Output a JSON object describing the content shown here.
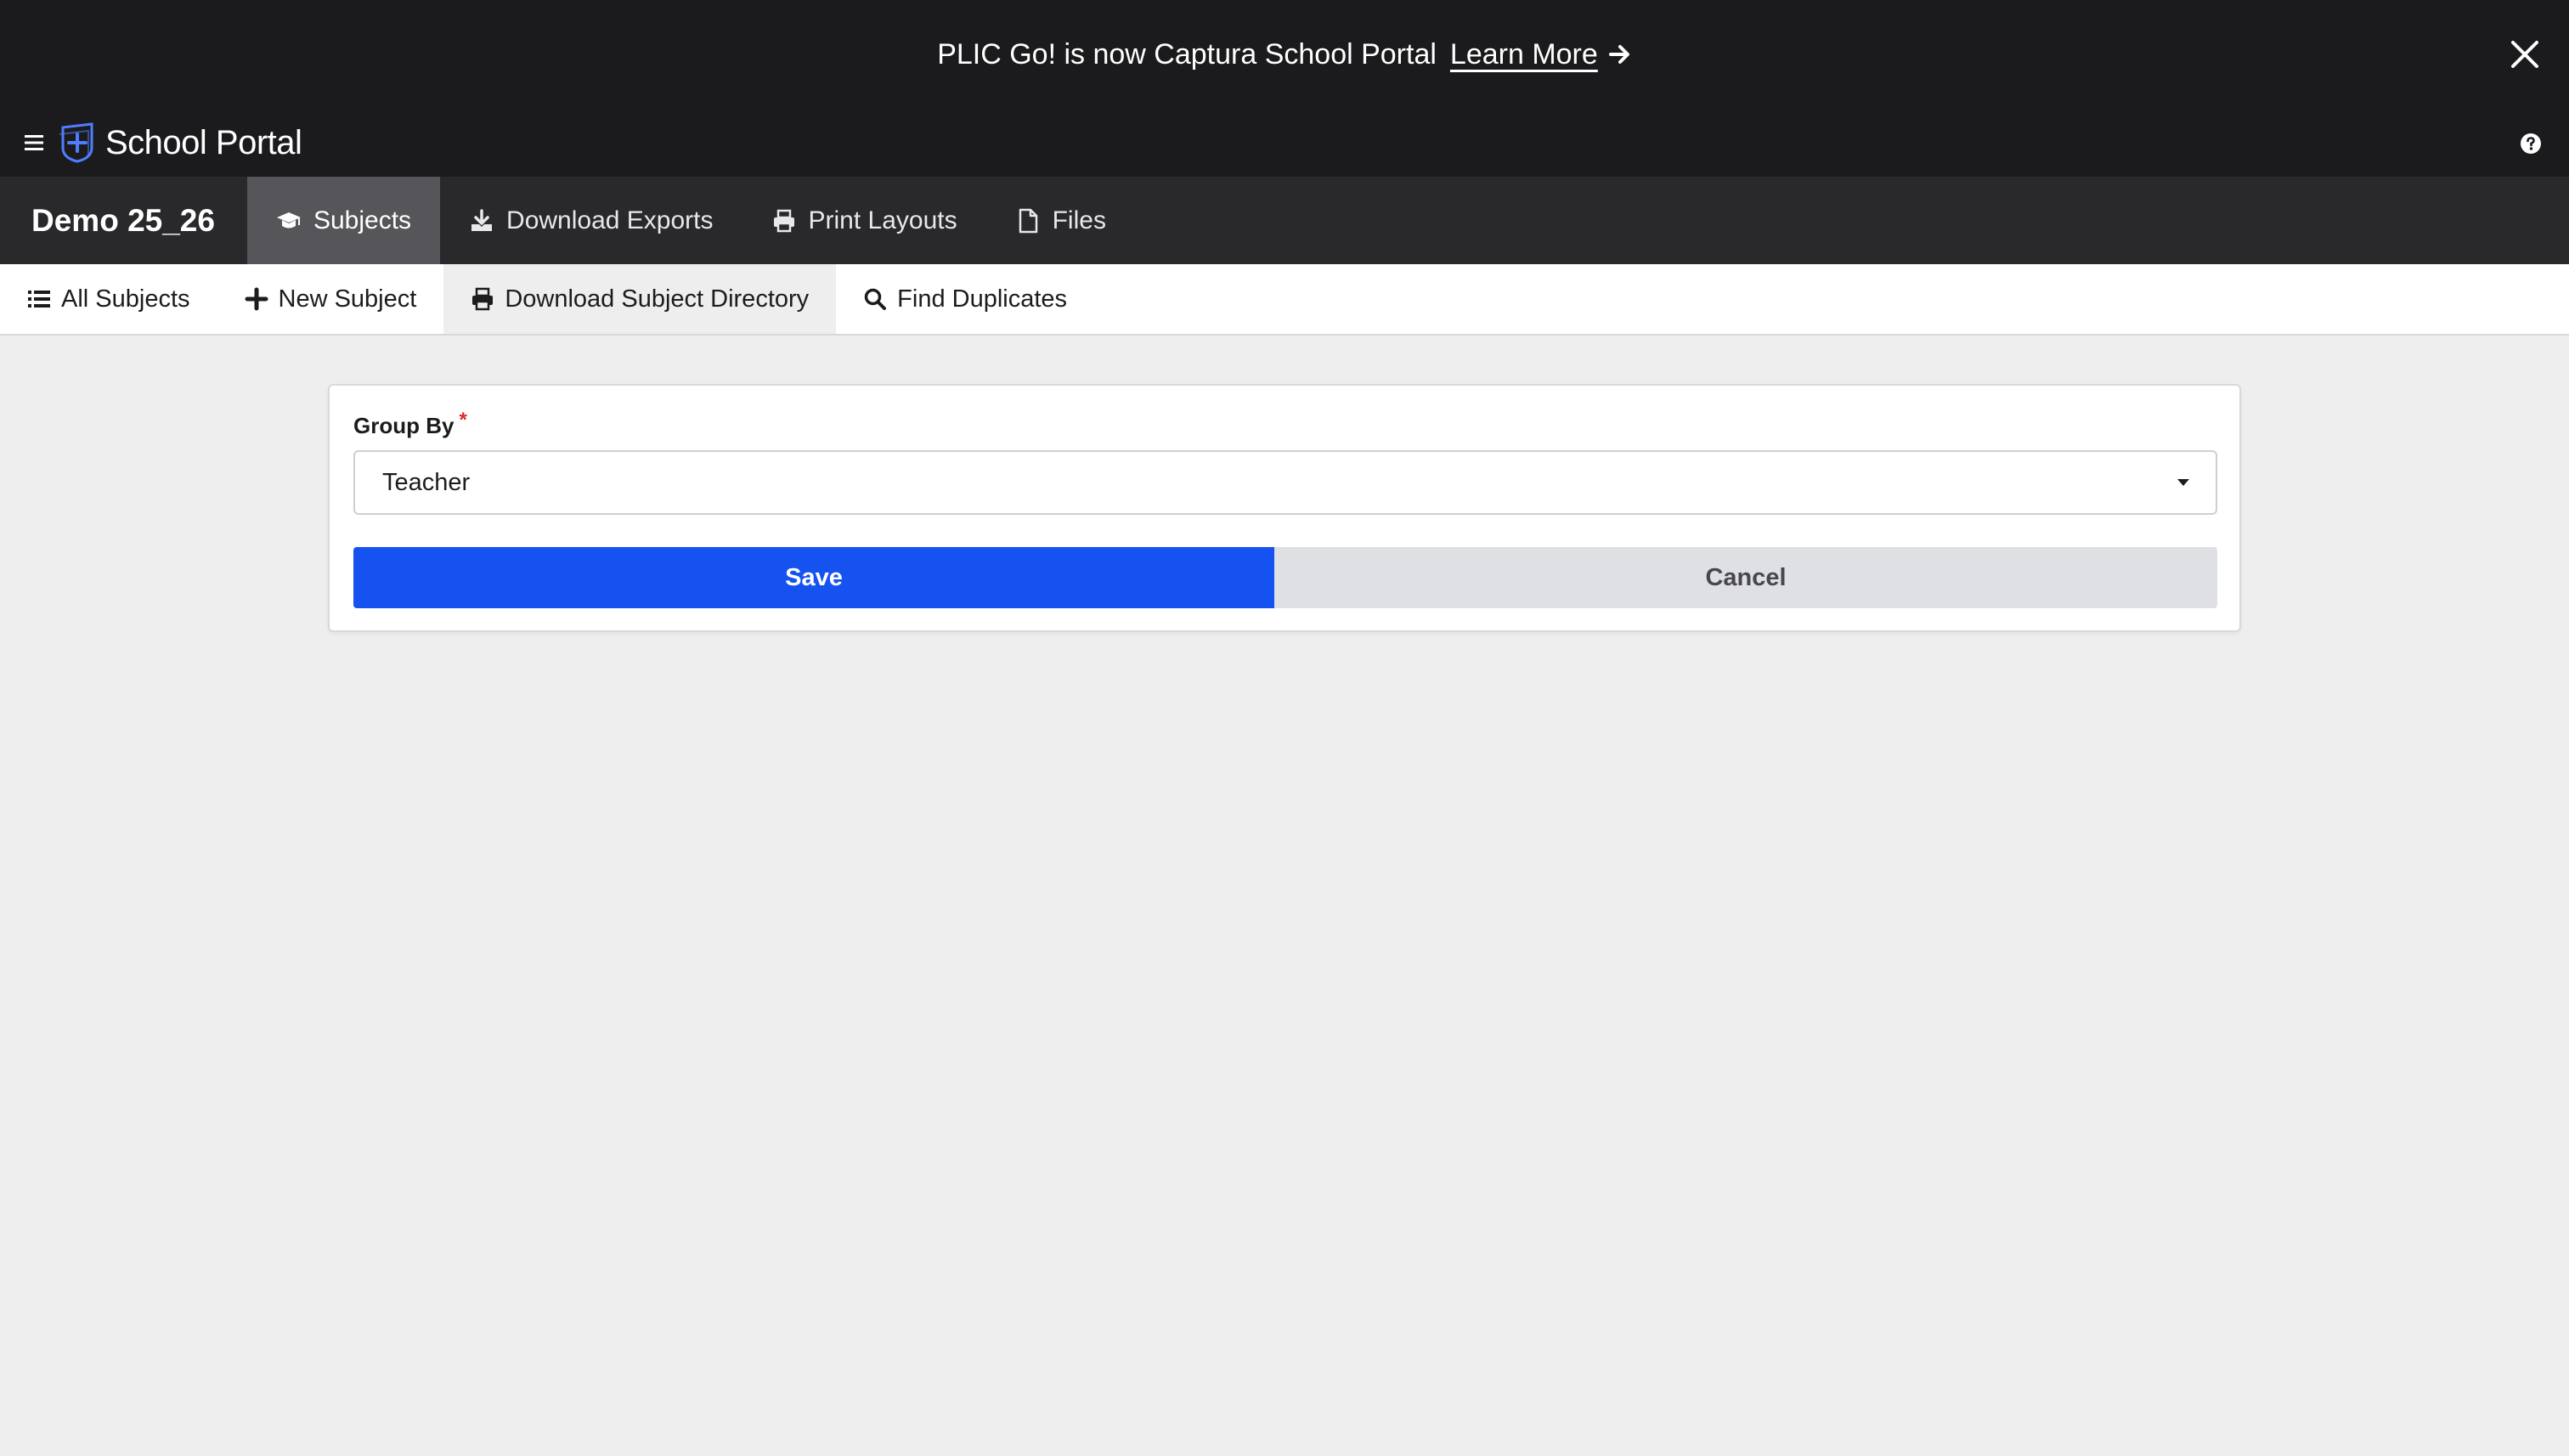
{
  "banner": {
    "message": "PLIC Go! is now Captura School Portal",
    "link_label": "Learn More",
    "icons": [
      "arrow-right-icon",
      "close-icon"
    ]
  },
  "app": {
    "brand": "School Portal",
    "icons": [
      "hamburger-menu-icon",
      "shield-plus-logo-icon",
      "help-circle-icon"
    ]
  },
  "navbar": {
    "project": "Demo 25_26",
    "tabs": [
      {
        "label": "Subjects",
        "icon": "graduation-cap-icon",
        "active": true
      },
      {
        "label": "Download Exports",
        "icon": "download-icon",
        "active": false
      },
      {
        "label": "Print Layouts",
        "icon": "print-icon",
        "active": false
      },
      {
        "label": "Files",
        "icon": "file-icon",
        "active": false
      }
    ]
  },
  "subnav": {
    "tabs": [
      {
        "label": "All Subjects",
        "icon": "list-icon",
        "active": false
      },
      {
        "label": "New Subject",
        "icon": "plus-icon",
        "active": false
      },
      {
        "label": "Download Subject Directory",
        "icon": "print-icon",
        "active": true
      },
      {
        "label": "Find Duplicates",
        "icon": "search-icon",
        "active": false
      }
    ]
  },
  "form": {
    "group_by_label": "Group By",
    "required_mark": "*",
    "group_by_value": "Teacher",
    "save_label": "Save",
    "cancel_label": "Cancel"
  },
  "colors": {
    "banner_bg": "#1b1b1d",
    "navbar_bg": "#29292c",
    "active_tab_bg": "#55555a",
    "primary": "#1552f0",
    "secondary_button": "#dfe0e3",
    "required": "#d92a2a",
    "page_bg": "#eeeeee",
    "logo_accent": "#4f7dff"
  }
}
